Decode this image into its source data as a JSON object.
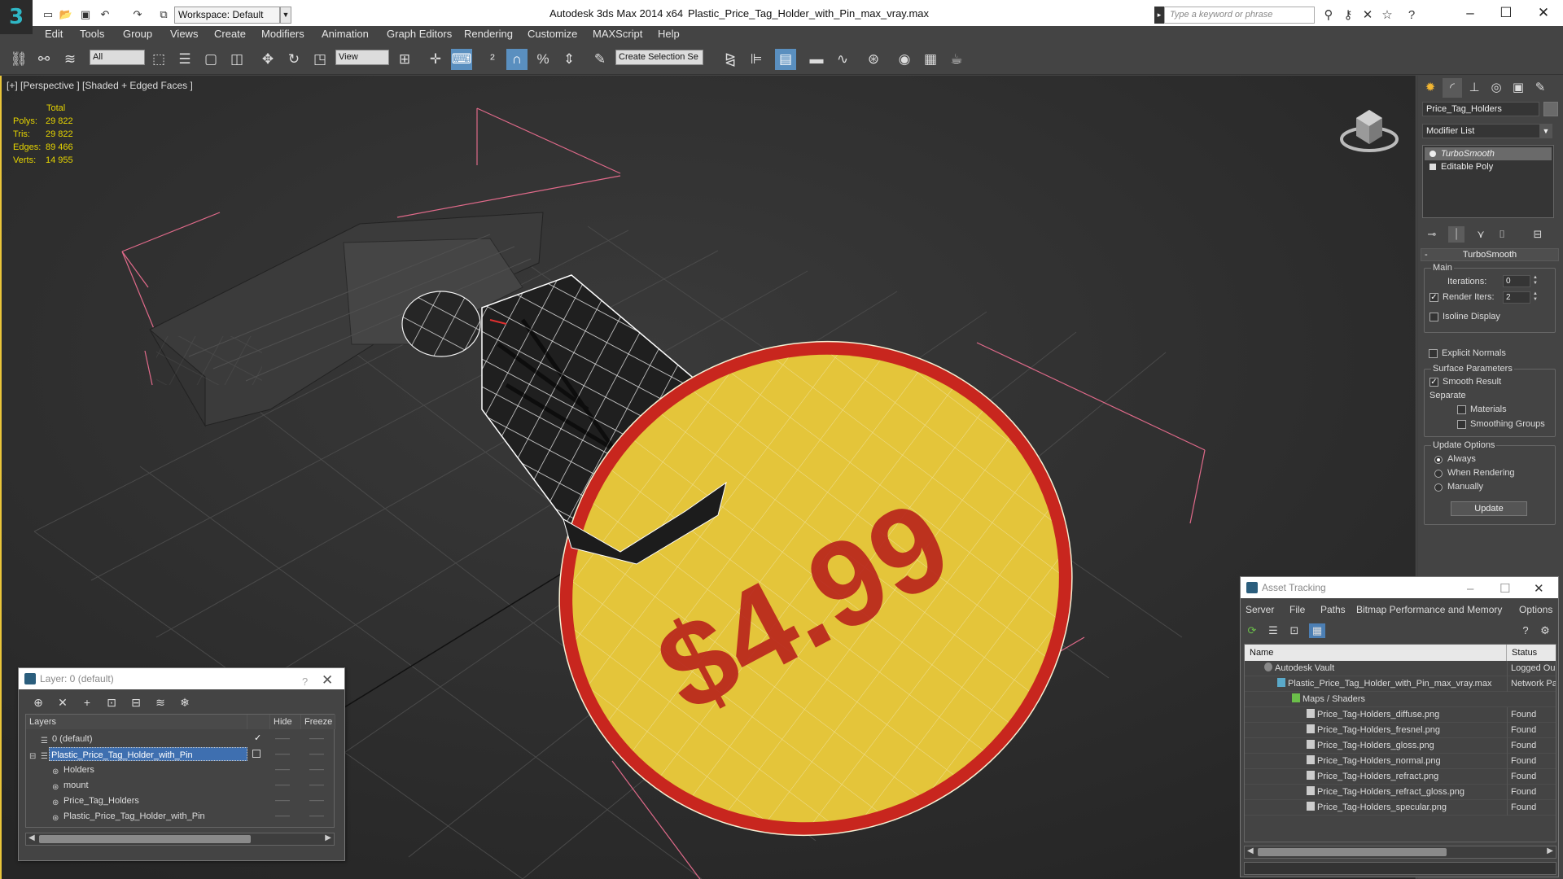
{
  "window": {
    "app_title": "Autodesk 3ds Max  2014 x64",
    "file_title": "Plastic_Price_Tag_Holder_with_Pin_max_vray.max",
    "workspace": "Workspace: Default",
    "search_placeholder": "Type a keyword or phrase"
  },
  "menu": [
    "Edit",
    "Tools",
    "Group",
    "Views",
    "Create",
    "Modifiers",
    "Animation",
    "Graph Editors",
    "Rendering",
    "Customize",
    "MAXScript",
    "Help"
  ],
  "toolbar": {
    "filter_value": "All",
    "reference_coord": "View",
    "selection_set_placeholder": "Create Selection Se"
  },
  "viewport": {
    "label": "[+] [Perspective ] [Shaded + Edged Faces ]",
    "stats_header": "Total",
    "stats": [
      {
        "label": "Polys:",
        "value": "29 822"
      },
      {
        "label": "Tris:",
        "value": "29 822"
      },
      {
        "label": "Edges:",
        "value": "89 466"
      },
      {
        "label": "Verts:",
        "value": "14 955"
      }
    ],
    "price_text": "$4.99",
    "colors": {
      "tag_fill": "#e4c53a",
      "tag_rim": "#c8261e",
      "price_text": "#b8231c",
      "bounding_box": "#e06a8a",
      "stats_text": "#e6d500"
    }
  },
  "command_panel": {
    "object_name": "Price_Tag_Holders",
    "modifier_list": "Modifier List",
    "stack": [
      "TurboSmooth",
      "Editable Poly"
    ],
    "rollout_title": "TurboSmooth",
    "main_group": "Main",
    "iterations_label": "Iterations:",
    "iterations_value": "0",
    "render_iters_label": "Render Iters:",
    "render_iters_value": "2",
    "isoline_label": "Isoline Display",
    "explicit_normals_label": "Explicit Normals",
    "surface_group": "Surface Parameters",
    "smooth_result_label": "Smooth Result",
    "separate_label": "Separate",
    "materials_label": "Materials",
    "smoothing_groups_label": "Smoothing Groups",
    "update_group": "Update Options",
    "always_label": "Always",
    "when_rendering_label": "When Rendering",
    "manually_label": "Manually",
    "update_button": "Update"
  },
  "layer_dialog": {
    "title": "Layer: 0 (default)",
    "help": "?",
    "columns": [
      "Layers",
      "Hide",
      "Freeze"
    ],
    "rows": [
      {
        "name": "0 (default)",
        "indent": 0,
        "checked": true,
        "selected": false
      },
      {
        "name": "Plastic_Price_Tag_Holder_with_Pin",
        "indent": 0,
        "checked": false,
        "selected": true
      },
      {
        "name": "Holders",
        "indent": 1,
        "checked": false,
        "selected": false
      },
      {
        "name": "mount",
        "indent": 1,
        "checked": false,
        "selected": false
      },
      {
        "name": "Price_Tag_Holders",
        "indent": 1,
        "checked": false,
        "selected": false
      },
      {
        "name": "Plastic_Price_Tag_Holder_with_Pin",
        "indent": 1,
        "checked": false,
        "selected": false
      }
    ]
  },
  "asset_tracking": {
    "title": "Asset Tracking",
    "menu": [
      "Server",
      "File",
      "Paths",
      "Bitmap Performance and Memory",
      "Options"
    ],
    "columns": [
      "Name",
      "Status"
    ],
    "rows": [
      {
        "name": "Autodesk Vault",
        "status": "Logged Ou",
        "level": 0,
        "icon": "vault"
      },
      {
        "name": "Plastic_Price_Tag_Holder_with_Pin_max_vray.max",
        "status": "Network Pa",
        "level": 1,
        "icon": "max"
      },
      {
        "name": "Maps / Shaders",
        "status": "",
        "level": 2,
        "icon": "folder"
      },
      {
        "name": "Price_Tag-Holders_diffuse.png",
        "status": "Found",
        "level": 3,
        "icon": "image"
      },
      {
        "name": "Price_Tag-Holders_fresnel.png",
        "status": "Found",
        "level": 3,
        "icon": "image"
      },
      {
        "name": "Price_Tag-Holders_gloss.png",
        "status": "Found",
        "level": 3,
        "icon": "image"
      },
      {
        "name": "Price_Tag-Holders_normal.png",
        "status": "Found",
        "level": 3,
        "icon": "image"
      },
      {
        "name": "Price_Tag-Holders_refract.png",
        "status": "Found",
        "level": 3,
        "icon": "image"
      },
      {
        "name": "Price_Tag-Holders_refract_gloss.png",
        "status": "Found",
        "level": 3,
        "icon": "image"
      },
      {
        "name": "Price_Tag-Holders_specular.png",
        "status": "Found",
        "level": 3,
        "icon": "image"
      }
    ]
  }
}
